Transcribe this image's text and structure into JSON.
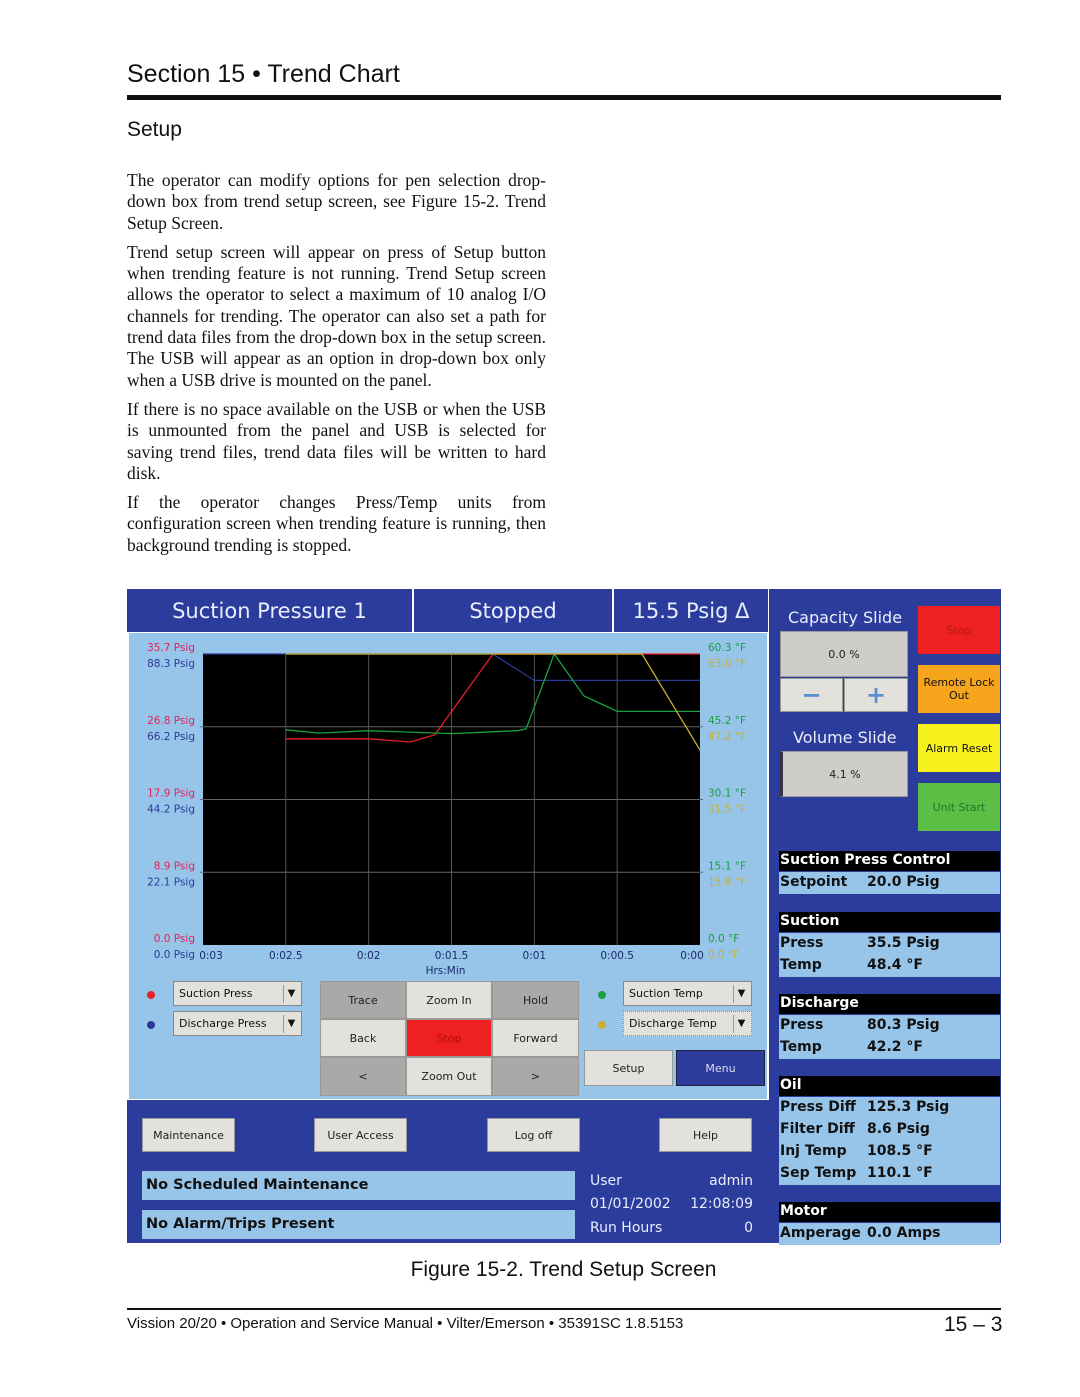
{
  "page": {
    "section_title": "Section 15 • Trend Chart",
    "subheading": "Setup",
    "paragraphs": [
      "The operator can modify options for pen selection drop-down box from trend setup screen, see Figure 15-2. Trend Setup Screen.",
      "Trend setup screen will appear on press of Setup button when trending feature is not running. Trend Setup screen allows the operator to select a maximum of 10 analog I/O channels for trending. The operator can also set a path for trend data files from the drop-down box in the setup screen. The USB will appear as an option in drop-down box only when a USB drive is mounted on the panel.",
      "If there is no space available on the USB or when the USB is unmounted from the panel and USB is selected for saving trend files, trend data files will be written to hard disk.",
      "If the operator changes Press/Temp units from configuration screen when trending feature is running, then background trending is stopped."
    ],
    "caption": "Figure 15-2. Trend Setup Screen",
    "footer": "Vission 20/20 • Operation and Service Manual • Vilter/Emerson • 35391SC 1.8.5153",
    "page_number": "15 – 3"
  },
  "screen": {
    "header": {
      "channel": "Suction Pressure 1",
      "state": "Stopped",
      "delta": "15.5 Psig Δ"
    },
    "left_axis_red": [
      "35.7 Psig",
      "26.8 Psig",
      "17.9 Psig",
      "8.9 Psig",
      "0.0 Psig"
    ],
    "left_axis_blue": [
      "88.3 Psig",
      "66.2 Psig",
      "44.2 Psig",
      "22.1 Psig",
      "0.0 Psig"
    ],
    "right_axis_green": [
      "60.3 °F",
      "45.2 °F",
      "30.1 °F",
      "15.1 °F",
      "0.0 °F"
    ],
    "right_axis_yellow": [
      "63.0 °F",
      "47.2 °F",
      "31.5 °F",
      "15.8 °F",
      "0.0 °F"
    ],
    "x_ticks": [
      "0:03",
      "0:02.5",
      "0:02",
      "0:01.5",
      "0:01",
      "0:00.5",
      "0:00"
    ],
    "x_label": "Hrs:Min",
    "pens": [
      {
        "label": "Suction Press",
        "color": "#e8202a"
      },
      {
        "label": "Discharge Press",
        "color": "#2a3a9a"
      },
      {
        "label": "Suction Temp",
        "color": "#1aa040"
      },
      {
        "label": "Discharge Temp",
        "color": "#c8b030"
      }
    ],
    "controls": [
      "Trace",
      "Zoom In",
      "Hold",
      "Back",
      "Stop",
      "Forward",
      "<",
      "Zoom Out",
      ">"
    ],
    "setup": "Setup",
    "menu": "Menu",
    "bottom_buttons": [
      "Maintenance",
      "User Access",
      "Log off",
      "Help"
    ],
    "status": [
      "No Scheduled Maintenance",
      "No Alarm/Trips Present"
    ],
    "info": {
      "user_label": "User",
      "user": "admin",
      "date": "01/01/2002",
      "time": "12:08:09",
      "run_hours_label": "Run Hours",
      "run_hours": "0"
    },
    "capacity": {
      "title": "Capacity Slide",
      "value": "0.0 %",
      "minus": "−",
      "plus": "+"
    },
    "volume": {
      "title": "Volume Slide",
      "value": "4.1 %"
    },
    "action_buttons": [
      {
        "label": "Stop",
        "color": "#ee2020"
      },
      {
        "label": "Remote Lock Out",
        "color": "#f7a51c"
      },
      {
        "label": "Alarm Reset",
        "color": "#f8f21c"
      },
      {
        "label": "Unit Start",
        "color": "#5cbf45"
      }
    ],
    "groups": [
      {
        "title": "Suction Press Control",
        "rows": [
          [
            "Setpoint",
            "20.0 Psig"
          ]
        ]
      },
      {
        "title": "Suction",
        "rows": [
          [
            "Press",
            "35.5 Psig"
          ],
          [
            "Temp",
            "48.4 °F"
          ]
        ]
      },
      {
        "title": "Discharge",
        "rows": [
          [
            "Press",
            "80.3 Psig"
          ],
          [
            "Temp",
            "42.2 °F"
          ]
        ]
      },
      {
        "title": "Oil",
        "rows": [
          [
            "Press Diff",
            "125.3 Psig"
          ],
          [
            "Filter Diff",
            "8.6 Psig"
          ],
          [
            "Inj Temp",
            "108.5 °F"
          ],
          [
            "Sep Temp",
            "110.1 °F"
          ]
        ]
      },
      {
        "title": "Motor",
        "rows": [
          [
            "Amperage",
            "0.0 Amps"
          ]
        ]
      }
    ]
  },
  "chart_data": {
    "type": "line",
    "xlabel": "Hrs:Min",
    "x_unit": "minutes before now",
    "xlim": [
      3,
      0
    ],
    "grid": true,
    "series": [
      {
        "name": "Suction Press",
        "color": "#e8202a",
        "ylim": [
          0,
          35.7
        ],
        "x": [
          2.5,
          2.0,
          1.75,
          1.6,
          1.25,
          0
        ],
        "y": [
          25.3,
          25.3,
          24.9,
          25.8,
          35.7,
          35.7
        ]
      },
      {
        "name": "Discharge Press",
        "color": "#2a3a9a",
        "ylim": [
          0,
          88.3
        ],
        "x": [
          3,
          1.25,
          1.0,
          0
        ],
        "y": [
          88.3,
          88.3,
          80.3,
          80.3
        ]
      },
      {
        "name": "Suction Temp",
        "color": "#1aa040",
        "ylim": [
          0,
          60.3
        ],
        "x": [
          2.5,
          2.3,
          2.0,
          1.5,
          1.1,
          1.05,
          0.88,
          0.7,
          0.5,
          0
        ],
        "y": [
          44.6,
          43.9,
          44.4,
          43.8,
          44.4,
          44.8,
          60.3,
          51.6,
          48.4,
          48.4
        ]
      },
      {
        "name": "Discharge Temp",
        "color": "#c8b030",
        "ylim": [
          0,
          63.0
        ],
        "x": [
          2.5,
          0.35,
          0
        ],
        "y": [
          63.0,
          63.0,
          42.2
        ]
      }
    ]
  }
}
